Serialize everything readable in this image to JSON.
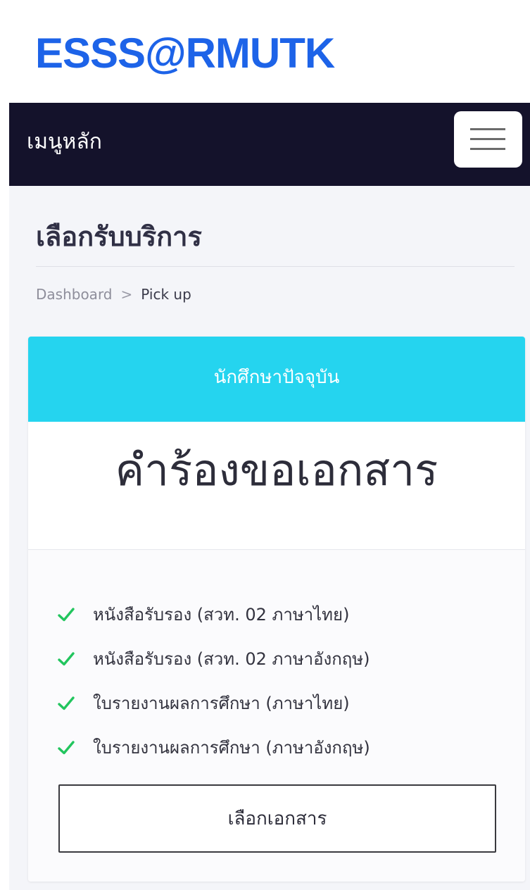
{
  "app": {
    "brand": "ESSS@RMUTK"
  },
  "navbar": {
    "title": "เมนูหลัก"
  },
  "page": {
    "title": "เลือกรับบริการ"
  },
  "breadcrumb": {
    "home": "Dashboard",
    "separator": ">",
    "current": "Pick up"
  },
  "card": {
    "header": "นักศึกษาปัจจุบัน",
    "title": "คำร้องขอเอกสาร",
    "features": [
      "หนังสือรับรอง (สวท. 02 ภาษาไทย)",
      "หนังสือรับรอง (สวท. 02 ภาษาอังกฤษ)",
      "ใบรายงานผลการศึกษา (ภาษาไทย)",
      "ใบรายงานผลการศึกษา (ภาษาอังกฤษ)"
    ],
    "button_label": "เลือกเอกสาร"
  },
  "icons": {
    "feature_check": "check-icon",
    "menu": "hamburger-icon"
  },
  "colors": {
    "brand": "#1d63e8",
    "navbar_bg": "#14122b",
    "card_header_bg": "#25d4ef",
    "check": "#22c55e"
  }
}
